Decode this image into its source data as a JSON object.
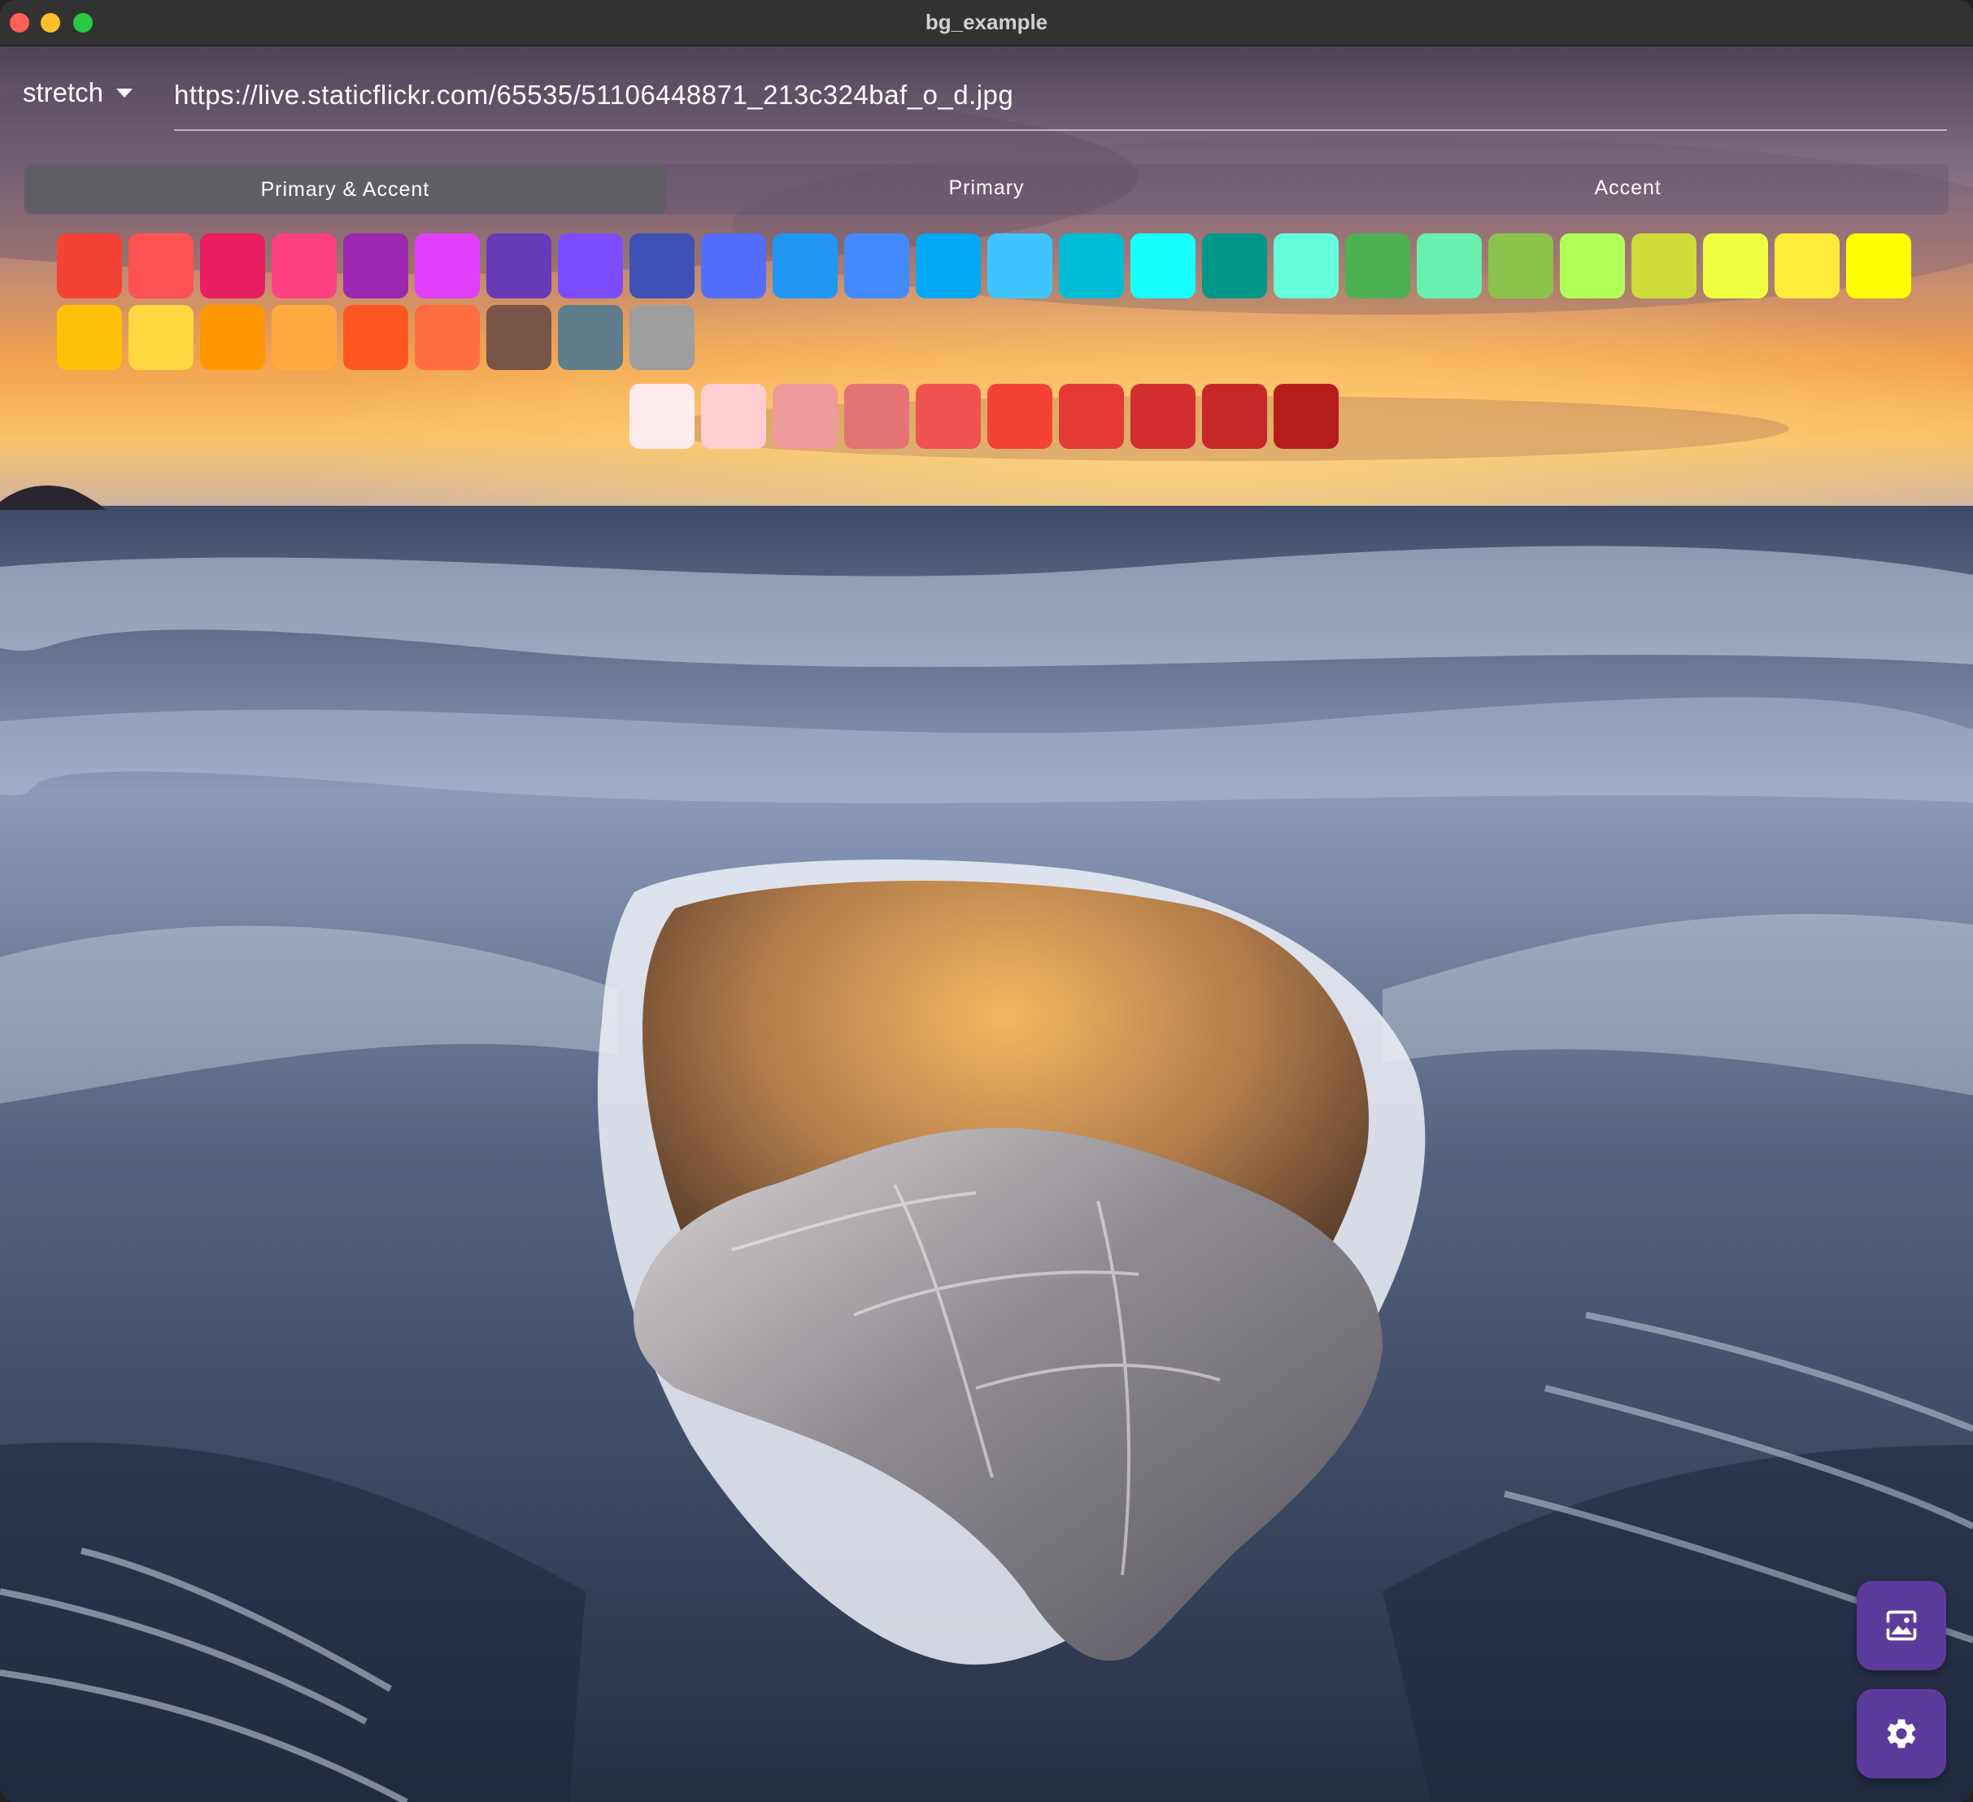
{
  "window": {
    "title": "bg_example"
  },
  "toolbar": {
    "mode_label": "stretch",
    "url_value": "https://live.staticflickr.com/65535/51106448871_213c324baf_o_d.jpg"
  },
  "tabs": [
    {
      "label": "Primary & Accent",
      "active": true
    },
    {
      "label": "Primary",
      "active": false
    },
    {
      "label": "Accent",
      "active": false
    }
  ],
  "palette": [
    "#f44336",
    "#ff5252",
    "#e91e63",
    "#ff4081",
    "#9c27b0",
    "#e040fb",
    "#673ab7",
    "#7c4dff",
    "#3f51b5",
    "#536dfe",
    "#2196f3",
    "#448aff",
    "#03a9f4",
    "#40c4ff",
    "#00bcd4",
    "#18ffff",
    "#009688",
    "#64ffda",
    "#4caf50",
    "#69f0ae",
    "#8bc34a",
    "#b2ff59",
    "#cddc39",
    "#eeff41",
    "#ffeb3b",
    "#ffff00",
    "#ffc107",
    "#ffd740",
    "#ff9800",
    "#ffab40",
    "#ff5722",
    "#ff6e40",
    "#795548",
    "#607d8b",
    "#9e9e9e"
  ],
  "shades": [
    "#ffebee",
    "#ffcdd2",
    "#ef9a9a",
    "#e57373",
    "#ef5350",
    "#f44336",
    "#e53935",
    "#d32f2f",
    "#c62828",
    "#b71c1c"
  ],
  "buttons": {
    "image_icon": "image-icon",
    "settings_icon": "gear-icon",
    "fab_color": "#5b3c9c"
  }
}
